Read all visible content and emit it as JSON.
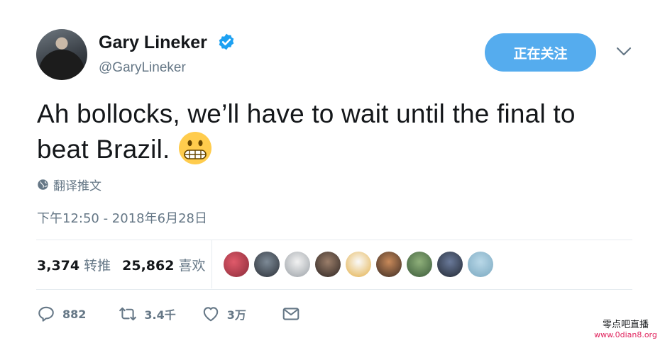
{
  "tweet": {
    "author_name": "Gary Lineker",
    "author_handle": "@GaryLineker",
    "verified": true,
    "follow_button_label": "正在关注",
    "text": "Ah bollocks, we’ll have to wait until the final to beat Brazil.",
    "emoji": "grimacing-face",
    "translate_label": "翻译推文",
    "timestamp": "下午12:50 - 2018年6月28日"
  },
  "stats": {
    "retweets_count": "3,374",
    "retweets_label": "转推",
    "likes_count": "25,862",
    "likes_label": "喜欢",
    "liker_avatar_count": 9
  },
  "actions": {
    "reply_count": "882",
    "retweet_count": "3.4千",
    "like_count": "3万"
  },
  "watermark": {
    "title": "零点吧直播",
    "url": "www.0dian8.org"
  },
  "colors": {
    "accent": "#55acee",
    "verified": "#1da1f2",
    "secondary_text": "#657786",
    "divider": "#e6ecf0"
  }
}
